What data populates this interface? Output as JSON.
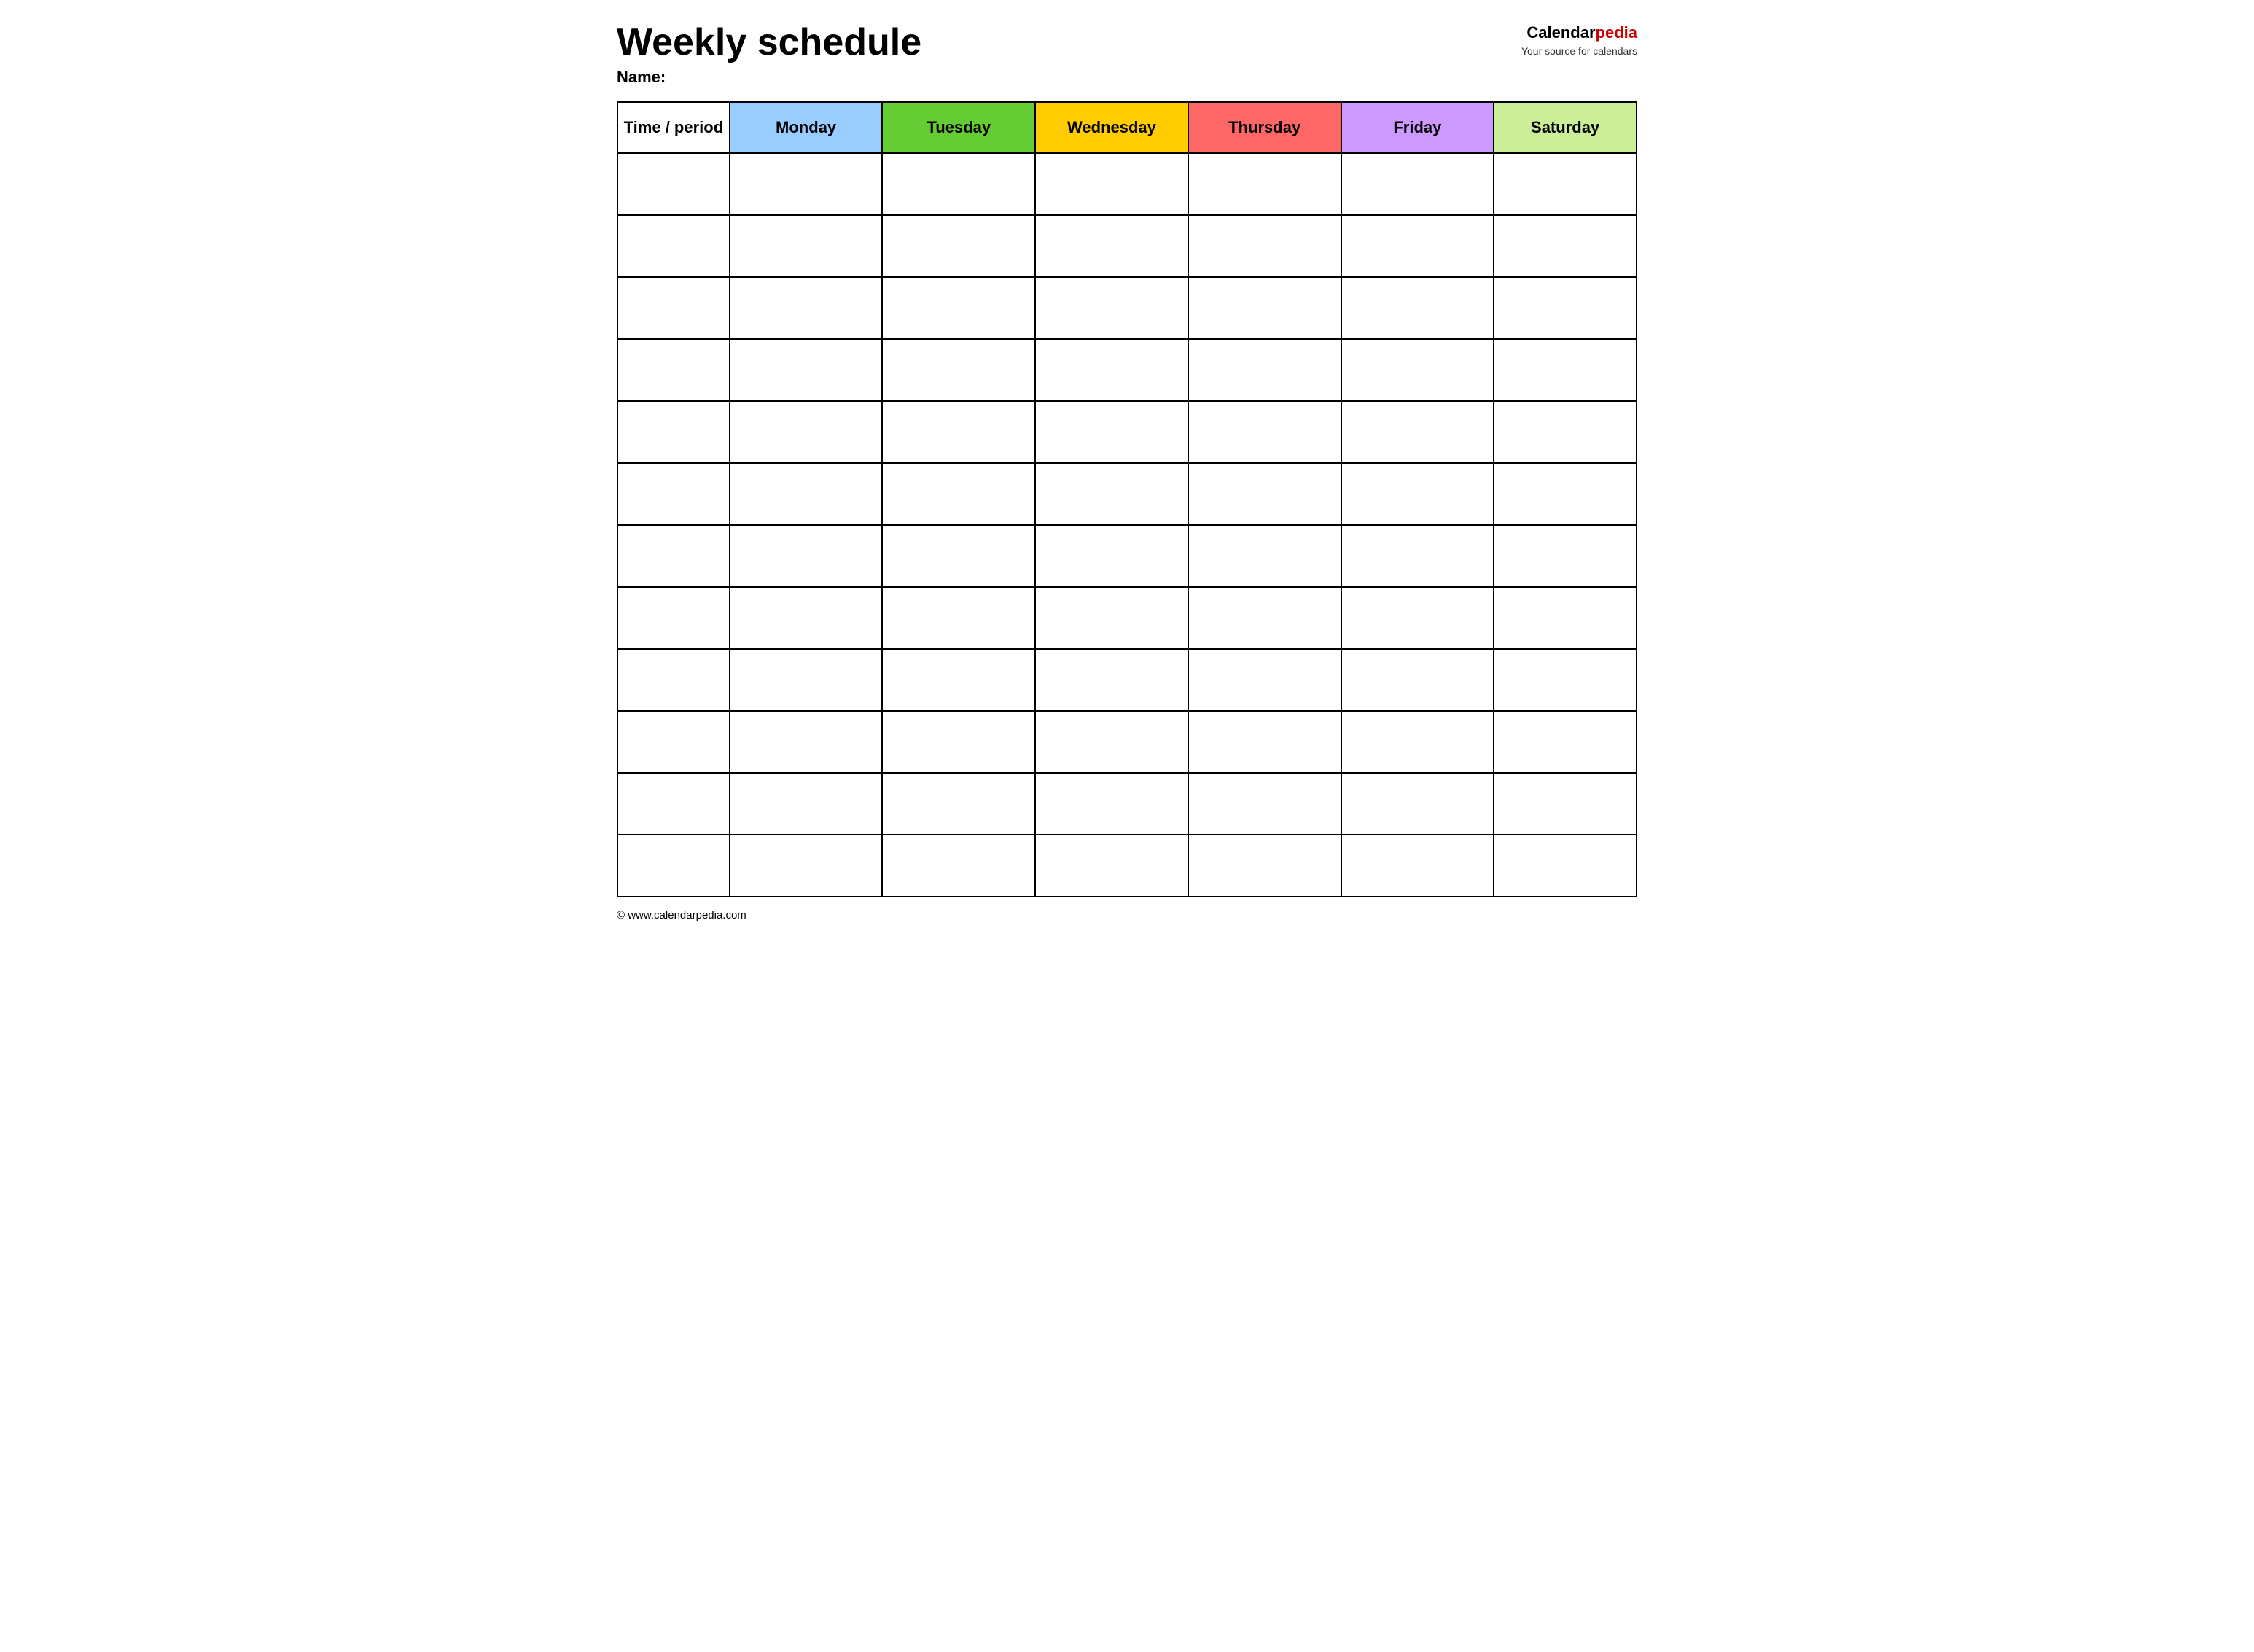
{
  "header": {
    "title": "Weekly schedule",
    "name_label": "Name:",
    "logo_brand_part1": "Calendar",
    "logo_brand_part2": "pedia",
    "logo_subtitle": "Your source for calendars"
  },
  "table": {
    "columns": [
      {
        "key": "time",
        "label": "Time / period",
        "color_class": "col-time"
      },
      {
        "key": "monday",
        "label": "Monday",
        "color_class": "col-monday"
      },
      {
        "key": "tuesday",
        "label": "Tuesday",
        "color_class": "col-tuesday"
      },
      {
        "key": "wednesday",
        "label": "Wednesday",
        "color_class": "col-wednesday"
      },
      {
        "key": "thursday",
        "label": "Thursday",
        "color_class": "col-thursday"
      },
      {
        "key": "friday",
        "label": "Friday",
        "color_class": "col-friday"
      },
      {
        "key": "saturday",
        "label": "Saturday",
        "color_class": "col-saturday"
      }
    ],
    "rows": 12
  },
  "footer": {
    "url": "© www.calendarpedia.com"
  }
}
